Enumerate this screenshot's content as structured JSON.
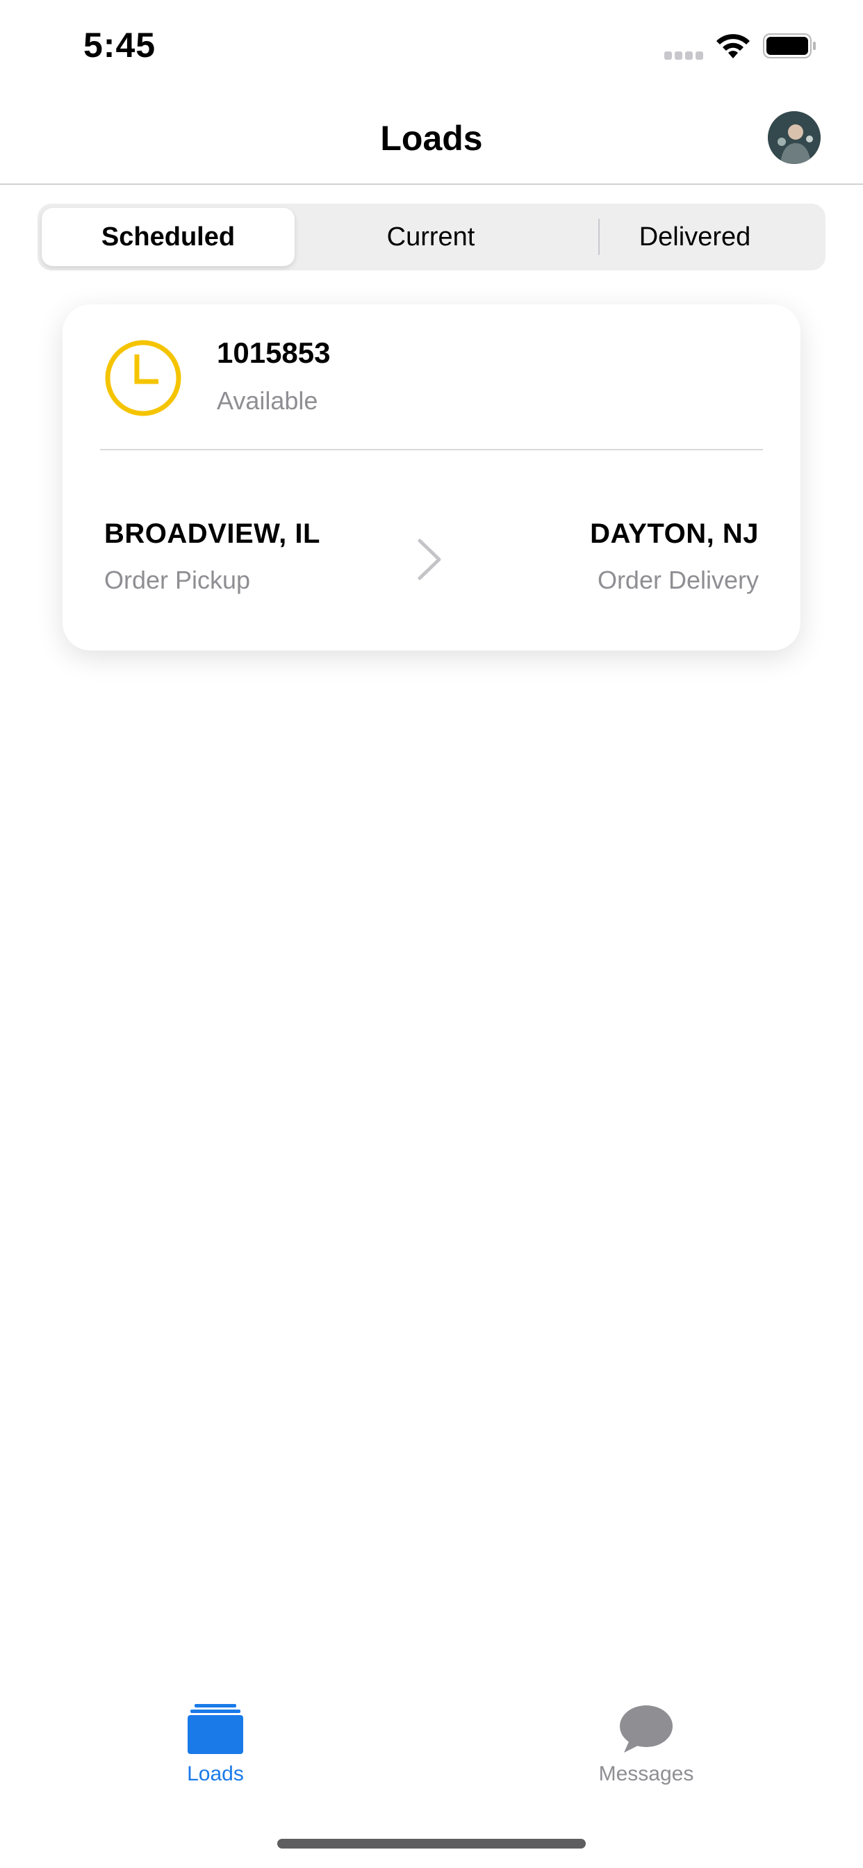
{
  "status_bar": {
    "time": "5:45"
  },
  "nav": {
    "title": "Loads"
  },
  "segments": [
    "Scheduled",
    "Current",
    "Delivered"
  ],
  "selected_segment": "Scheduled",
  "load": {
    "number": "1015853",
    "status": "Available",
    "status_color": "#F5C400",
    "origin_city": "BROADVIEW, IL",
    "origin_label": "Order Pickup",
    "destination_city": "DAYTON, NJ",
    "destination_label": "Order Delivery"
  },
  "tabs": [
    {
      "label": "Loads",
      "icon": "stack-icon",
      "active": true
    },
    {
      "label": "Messages",
      "icon": "chat-bubble-icon",
      "active": false
    }
  ],
  "colors": {
    "accent": "#1A7AE8",
    "inactive": "#8E8E93",
    "clock": "#F5C400"
  }
}
